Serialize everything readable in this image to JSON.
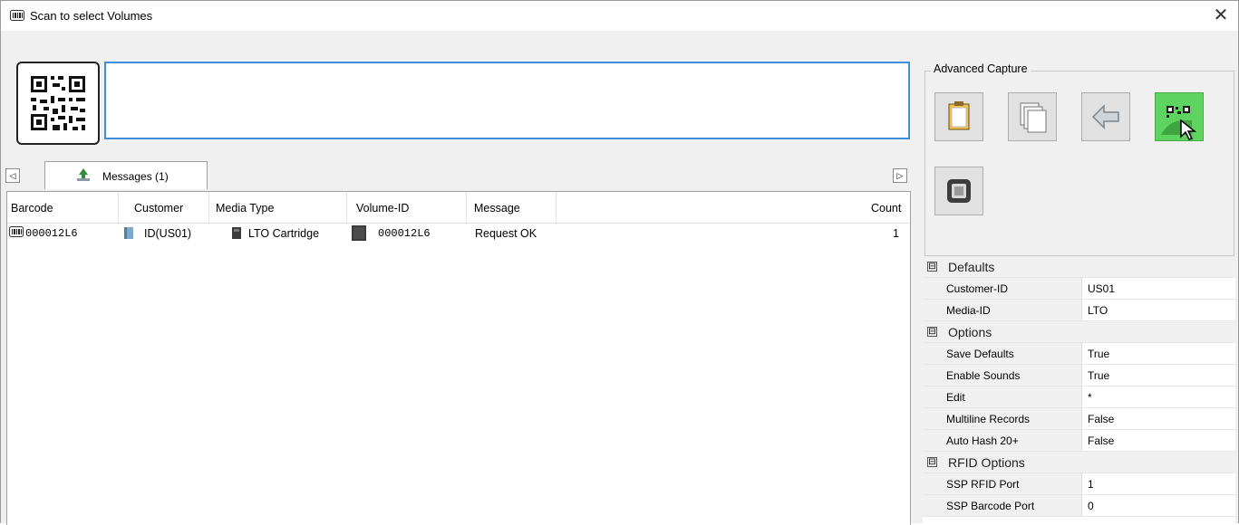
{
  "window": {
    "title": "Scan to select Volumes",
    "close_glyph": "✕"
  },
  "tabs": {
    "active_label": "Messages (1)",
    "left_arrow": "◁",
    "right_arrow": "▷"
  },
  "table": {
    "columns": [
      "Barcode",
      "Customer",
      "Media Type",
      "Volume-ID",
      "Message",
      "Count"
    ],
    "rows": [
      {
        "barcode": "000012L6",
        "customer": "ID(US01)",
        "media_type": "LTO Cartridge",
        "volume_id": "000012L6",
        "message": "Request OK",
        "count": "1"
      }
    ]
  },
  "advanced_capture": {
    "label": "Advanced Capture",
    "active_color": "#5fd35f"
  },
  "properties": {
    "categories": [
      {
        "name": "Defaults",
        "expander": "⊟",
        "items": [
          {
            "name": "Customer-ID",
            "value": "US01"
          },
          {
            "name": "Media-ID",
            "value": "LTO"
          }
        ]
      },
      {
        "name": "Options",
        "expander": "⊟",
        "items": [
          {
            "name": "Save Defaults",
            "value": "True"
          },
          {
            "name": "Enable Sounds",
            "value": "True"
          },
          {
            "name": "Edit",
            "value": "*"
          },
          {
            "name": "Multiline Records",
            "value": "False"
          },
          {
            "name": "Auto Hash 20+",
            "value": "False"
          }
        ]
      },
      {
        "name": "RFID Options",
        "expander": "⊟",
        "items": [
          {
            "name": "SSP RFID Port",
            "value": "1"
          },
          {
            "name": "SSP Barcode Port",
            "value": "0"
          }
        ]
      }
    ]
  }
}
